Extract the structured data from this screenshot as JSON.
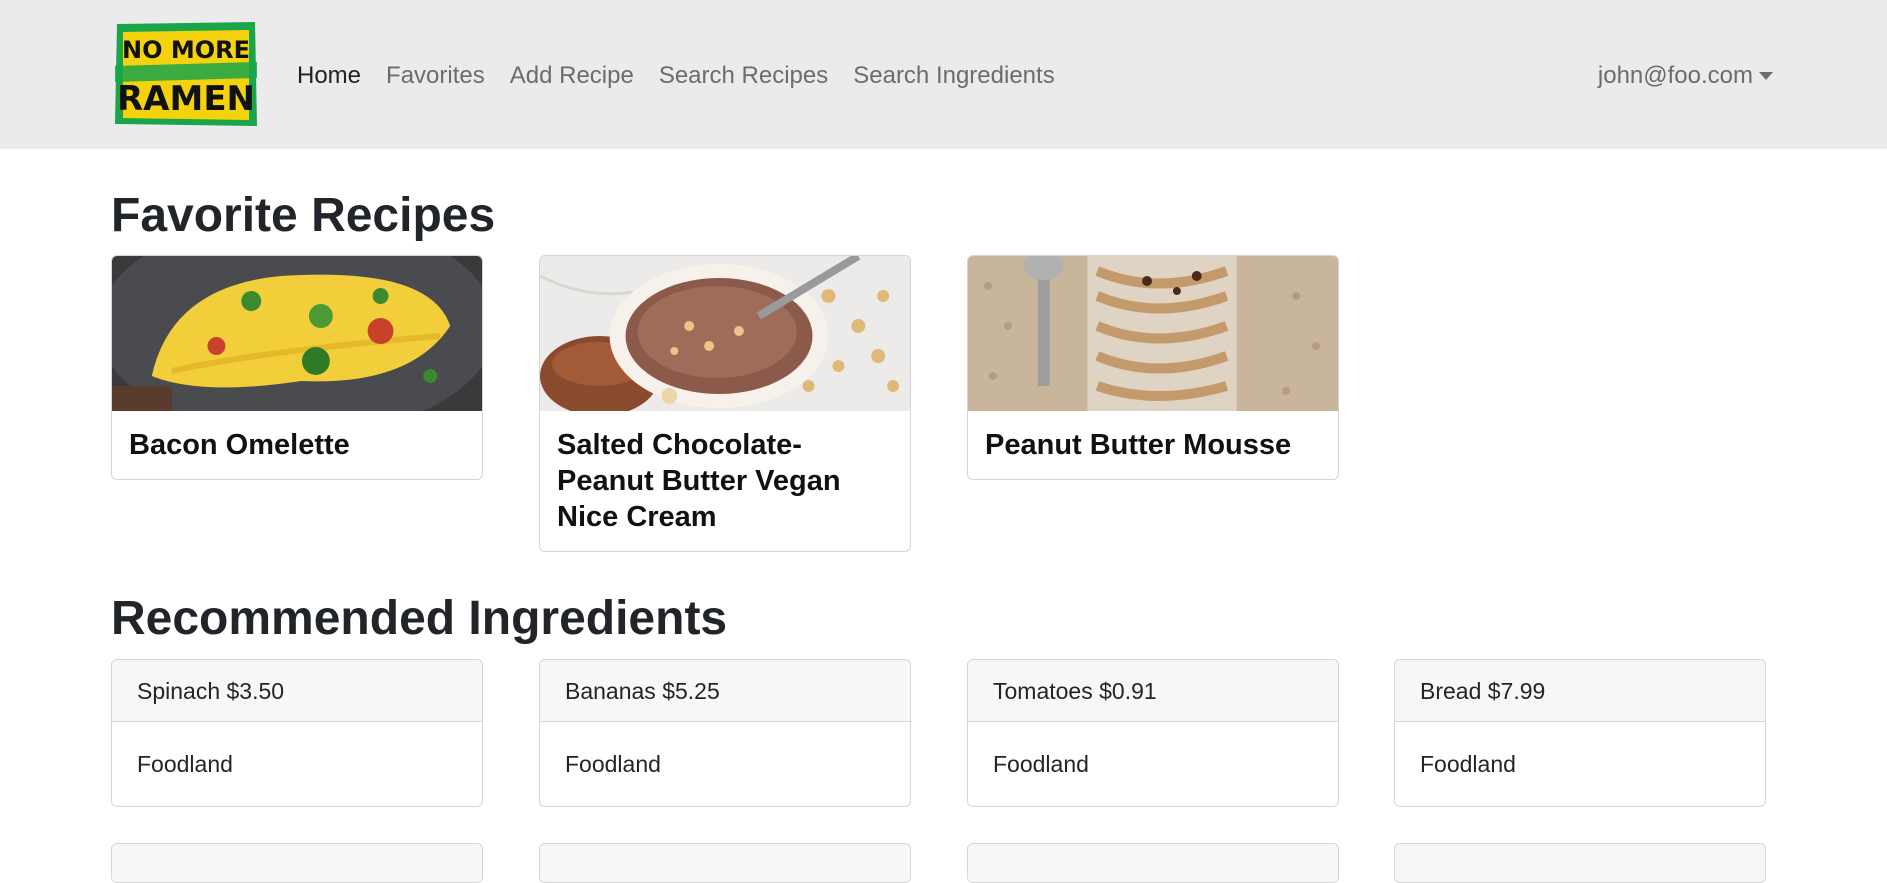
{
  "brand": {
    "logo_text_line1": "NO MORE",
    "logo_text_line2": "RAMEN"
  },
  "nav": {
    "items": [
      {
        "label": "Home",
        "active": true
      },
      {
        "label": "Favorites"
      },
      {
        "label": "Add Recipe"
      },
      {
        "label": "Search Recipes"
      },
      {
        "label": "Search Ingredients"
      }
    ],
    "user": "john@foo.com"
  },
  "favorites": {
    "title": "Favorite Recipes",
    "recipes": [
      {
        "title": "Bacon Omelette"
      },
      {
        "title": "Salted Chocolate-Peanut Butter Vegan Nice Cream"
      },
      {
        "title": "Peanut Butter Mousse"
      }
    ]
  },
  "recommended": {
    "title": "Recommended Ingredients",
    "ingredients": [
      {
        "name_price": "Spinach $3.50",
        "store": "Foodland"
      },
      {
        "name_price": "Bananas $5.25",
        "store": "Foodland"
      },
      {
        "name_price": "Tomatoes $0.91",
        "store": "Foodland"
      },
      {
        "name_price": "Bread $7.99",
        "store": "Foodland"
      }
    ]
  },
  "colors": {
    "navbar_bg": "#ebebeb",
    "logo_green": "#1aa54a",
    "logo_yellow": "#f5d30c"
  }
}
